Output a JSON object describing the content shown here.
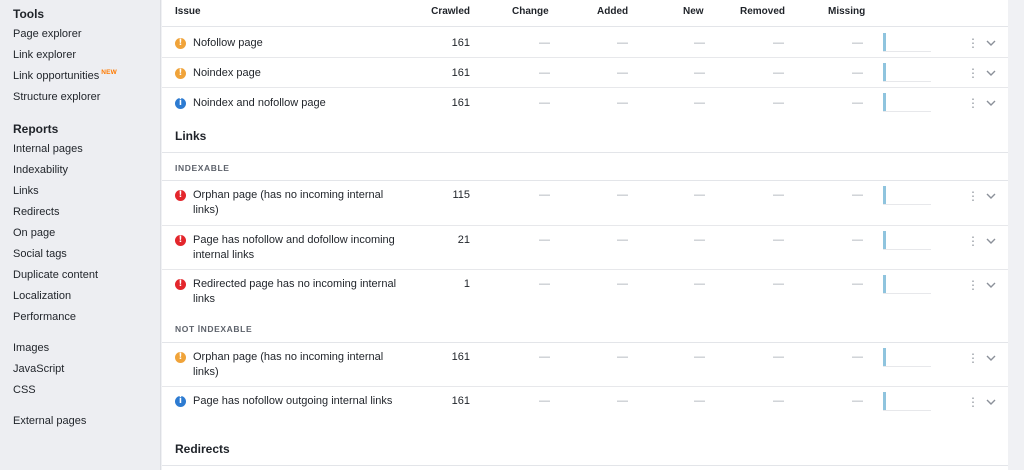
{
  "sidebar": {
    "tools_title": "Tools",
    "tools": [
      {
        "label": "Page explorer"
      },
      {
        "label": "Link explorer"
      },
      {
        "label": "Link opportunities",
        "badge": "NEW"
      },
      {
        "label": "Structure explorer"
      }
    ],
    "reports_title": "Reports",
    "reports": [
      {
        "label": "Internal pages"
      },
      {
        "label": "Indexability"
      },
      {
        "label": "Links"
      },
      {
        "label": "Redirects"
      },
      {
        "label": "On page"
      },
      {
        "label": "Social tags"
      },
      {
        "label": "Duplicate content"
      },
      {
        "label": "Localization"
      },
      {
        "label": "Performance"
      }
    ],
    "resources": [
      {
        "label": "Images"
      },
      {
        "label": "JavaScript"
      },
      {
        "label": "CSS"
      }
    ],
    "external": {
      "label": "External pages"
    }
  },
  "table": {
    "columns": {
      "issue": "Issue",
      "crawled": "Crawled",
      "change": "Change",
      "added": "Added",
      "new": "New",
      "removed": "Removed",
      "missing": "Missing"
    },
    "dash": "—",
    "sections": {
      "links": "Links",
      "indexable": "INDEXABLE",
      "not_indexable": "NOT İNDEXABLE",
      "redirects": "Redirects"
    },
    "rows": [
      {
        "severity": "warning",
        "glyph": "!",
        "issue": "Nofollow page",
        "crawled": "161"
      },
      {
        "severity": "warning",
        "glyph": "!",
        "issue": "Noindex page",
        "crawled": "161"
      },
      {
        "severity": "notice",
        "glyph": "i",
        "issue": "Noindex and nofollow page",
        "crawled": "161"
      },
      {
        "severity": "error",
        "glyph": "!",
        "issue": "Orphan page (has no incoming internal links)",
        "crawled": "115"
      },
      {
        "severity": "error",
        "glyph": "!",
        "issue": "Page has nofollow and dofollow incoming internal links",
        "crawled": "21"
      },
      {
        "severity": "error",
        "glyph": "!",
        "issue": "Redirected page has no incoming internal links",
        "crawled": "1"
      },
      {
        "severity": "warning",
        "glyph": "!",
        "issue": "Orphan page (has no incoming internal links)",
        "crawled": "161"
      },
      {
        "severity": "notice",
        "glyph": "i",
        "issue": "Page has nofollow outgoing internal links",
        "crawled": "161"
      }
    ]
  },
  "colors": {
    "warning": "#f0a339",
    "error": "#e3262c",
    "notice": "#2d7bd1",
    "new_badge": "#ff7a00",
    "spark_bar": "#8fc4de"
  },
  "icons": {
    "kebab": "kebab-menu-icon",
    "expand": "chevron-down-icon",
    "severity": "severity-icon"
  }
}
